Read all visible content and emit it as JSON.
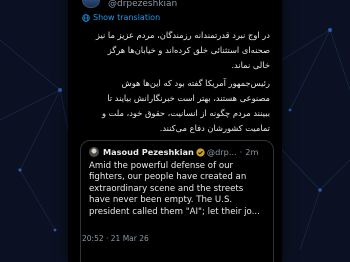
{
  "tweet": {
    "handle": "@drpezeshkian",
    "translate_label": "Show translation",
    "text_lines": [
      "در اوج نبرد قدرتمندانه رزمندگان، مردم عزیز ما نیز",
      "صحنه‌ای استثنائی خلق کرده‌اند و خیابان‌ها هرگز",
      "خالی نماند.",
      "رئیس‌جمهور آمریکا گفته بود که این‌ها هوش",
      "مصنوعی هستند، بهتر است خبرنگارانش بیایند تا",
      "ببینند مردم چگونه از انسانیت، حقوق خود، ملت و",
      "تمامیت کشورشان دفاع می‌کنند."
    ],
    "timestamp": "20:52 · 21 Mar 26"
  },
  "quote": {
    "name": "Masoud Pezeshkian",
    "handle": "@drp...",
    "separator": "·",
    "time": "2m",
    "text": "Amid the powerful defense of our fighters, our people have created an extraordinary scene and the streets have never been empty. The U.S. president called them \"AI\"; let their jo..."
  },
  "colors": {
    "background": "#0b1122",
    "card": "#000000",
    "link": "#1d9bf0",
    "muted": "#8b98a5",
    "text": "#e7e9ea"
  }
}
